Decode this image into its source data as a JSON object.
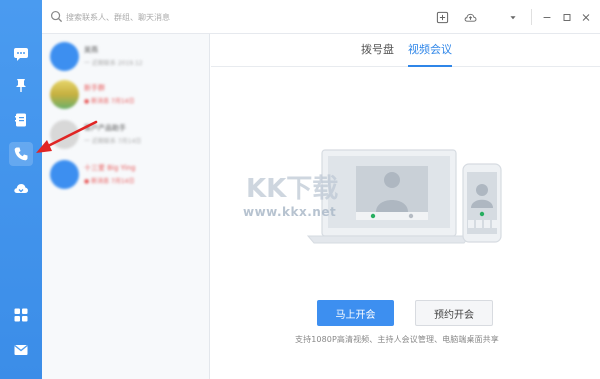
{
  "search": {
    "placeholder": "搜索联系人、群组、聊天消息"
  },
  "toolbar": {
    "icons": [
      "add-box-icon",
      "cloud-upload-icon",
      "dropdown-icon",
      "minimize-icon",
      "maximize-icon",
      "close-icon"
    ]
  },
  "sidebar": {
    "items": [
      {
        "name": "chat-icon"
      },
      {
        "name": "pin-icon"
      },
      {
        "name": "contacts-book-icon"
      },
      {
        "name": "phone-icon",
        "active": true
      },
      {
        "name": "cloud-drive-icon"
      },
      {
        "name": "apps-grid-icon"
      },
      {
        "name": "mail-icon"
      }
    ]
  },
  "contacts": [
    {
      "name": "吴燕",
      "sub": "一 近期联系 2019.12",
      "color": "#3d8ff0",
      "red": false
    },
    {
      "name": "新手群",
      "sub": "● 新消息 7月14日",
      "color": "#d4c04a",
      "red": true
    },
    {
      "name": "客户产品助手",
      "sub": "一 近期联系 7月14日",
      "color": "#dcdcdc",
      "red": false
    },
    {
      "name": "十三爱 Big Ying",
      "sub": "● 新消息 7月14日",
      "color": "#3d8ff0",
      "red": true
    }
  ],
  "tabs": {
    "dialpad": "拨号盘",
    "video": "视频会议"
  },
  "actions": {
    "start": "马上开会",
    "book": "预约开会"
  },
  "hint": "支持1080P高清视频、主持人会议管理、电脑端桌面共享",
  "watermark": {
    "logo": "KK下载",
    "url": "www.kkx.net"
  },
  "colors": {
    "accent": "#3d8ff0",
    "rail": "#4a9bf0",
    "alert": "#e85a5a"
  }
}
